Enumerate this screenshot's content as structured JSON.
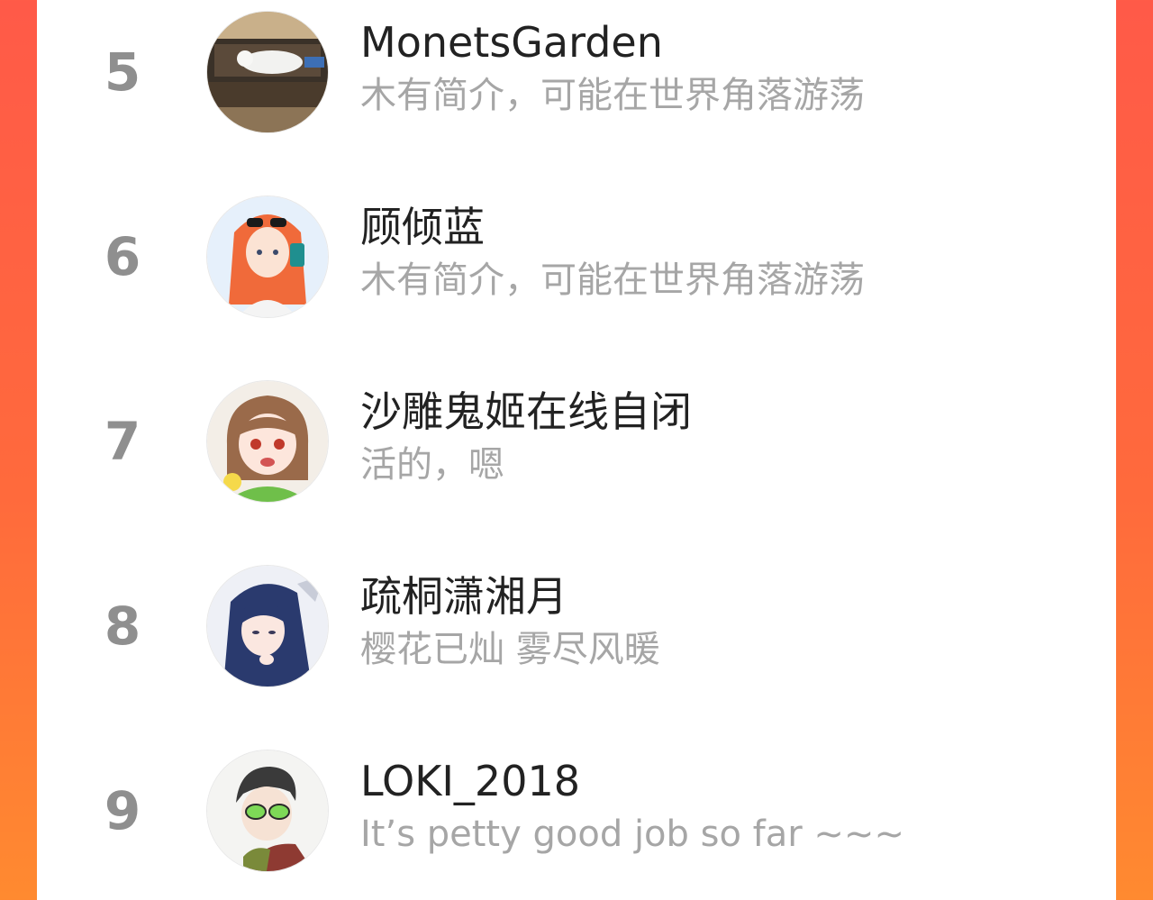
{
  "ranking": {
    "items": [
      {
        "rank": "5",
        "name": "MonetsGarden",
        "bio": "木有简介，可能在世界角落游荡",
        "avatar_icon": "cat-on-shelf-avatar"
      },
      {
        "rank": "6",
        "name": "顾倾蓝",
        "bio": "木有简介，可能在世界角落游荡",
        "avatar_icon": "girl-with-sunglasses-avatar"
      },
      {
        "rank": "7",
        "name": "沙雕鬼姬在线自闭",
        "bio": "活的，嗯",
        "avatar_icon": "anime-girl-avatar"
      },
      {
        "rank": "8",
        "name": "疏桐潇湘月",
        "bio": "樱花已灿 雾尽风暖",
        "avatar_icon": "blue-hair-girl-avatar"
      },
      {
        "rank": "9",
        "name": "LOKI_2018",
        "bio": "It’s petty good job so far ~~~",
        "avatar_icon": "man-with-green-glasses-avatar"
      }
    ]
  },
  "colors": {
    "background_red": "#ff5a48",
    "background_orange": "#ff8a30",
    "rank_gray": "#8f8f8f",
    "name_black": "#222222",
    "bio_gray": "#a6a6a6"
  }
}
